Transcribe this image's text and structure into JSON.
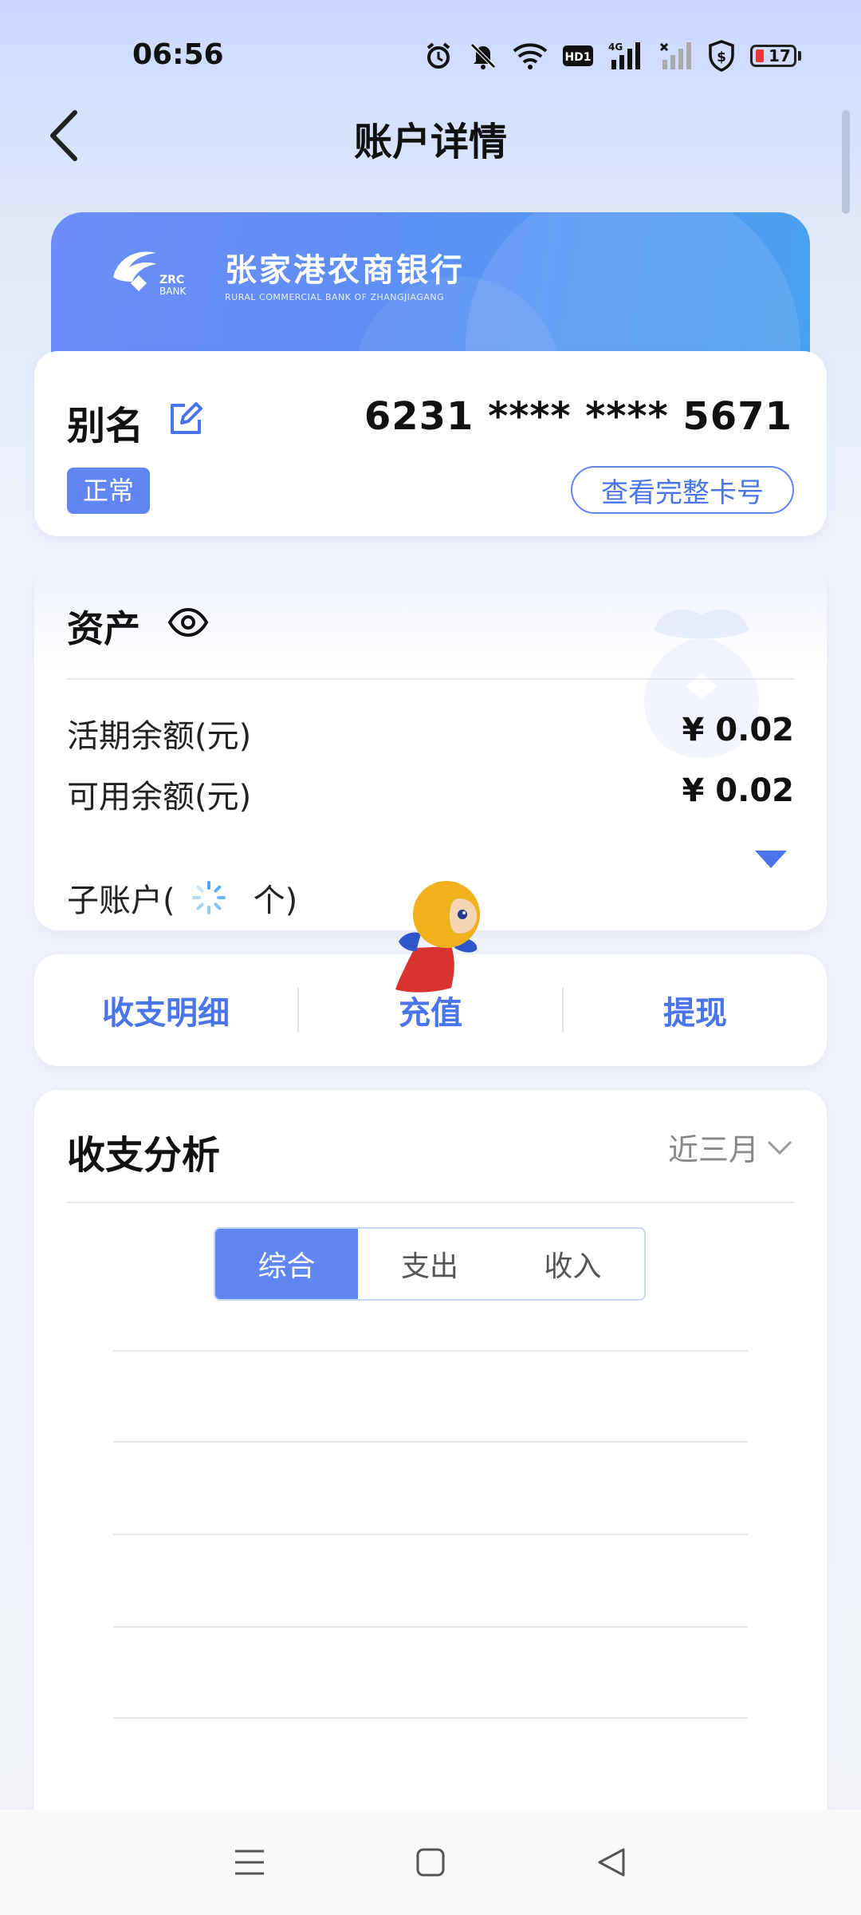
{
  "status_bar": {
    "time": "06:56",
    "battery": "17",
    "network": "4G",
    "hd": "HD1"
  },
  "header": {
    "title": "账户详情"
  },
  "bank": {
    "name_cn": "张家港农商银行",
    "name_en": "RURAL COMMERCIAL BANK OF ZHANGJIAGANG",
    "logo_text_1": "ZRC",
    "logo_text_2": "BANK"
  },
  "card": {
    "alias_label": "别名",
    "number": "6231 **** **** 5671",
    "status": "正常",
    "view_full_label": "查看完整卡号"
  },
  "assets": {
    "title": "资产",
    "rows": [
      {
        "label": "活期余额(元)",
        "value": "¥ 0.02"
      },
      {
        "label": "可用余额(元)",
        "value": "¥ 0.02"
      }
    ],
    "sub_account_prefix": "子账户(",
    "sub_account_suffix": "个)"
  },
  "actions": [
    "收支明细",
    "充值",
    "提现"
  ],
  "analysis": {
    "title": "收支分析",
    "period": "近三月",
    "tabs": [
      "综合",
      "支出",
      "收入"
    ],
    "active_tab": "综合"
  },
  "colors": {
    "accent": "#5f86f2",
    "text_accent": "#4a74ea",
    "card_gradient_start": "#6d8df7",
    "card_gradient_end": "#4aa1ef"
  },
  "icons": [
    "back-icon",
    "edit-icon",
    "eye-icon",
    "expand-triangle-icon",
    "chevron-down-icon",
    "menu-icon",
    "home-icon",
    "back-nav-icon",
    "loading-spinner-icon"
  ]
}
